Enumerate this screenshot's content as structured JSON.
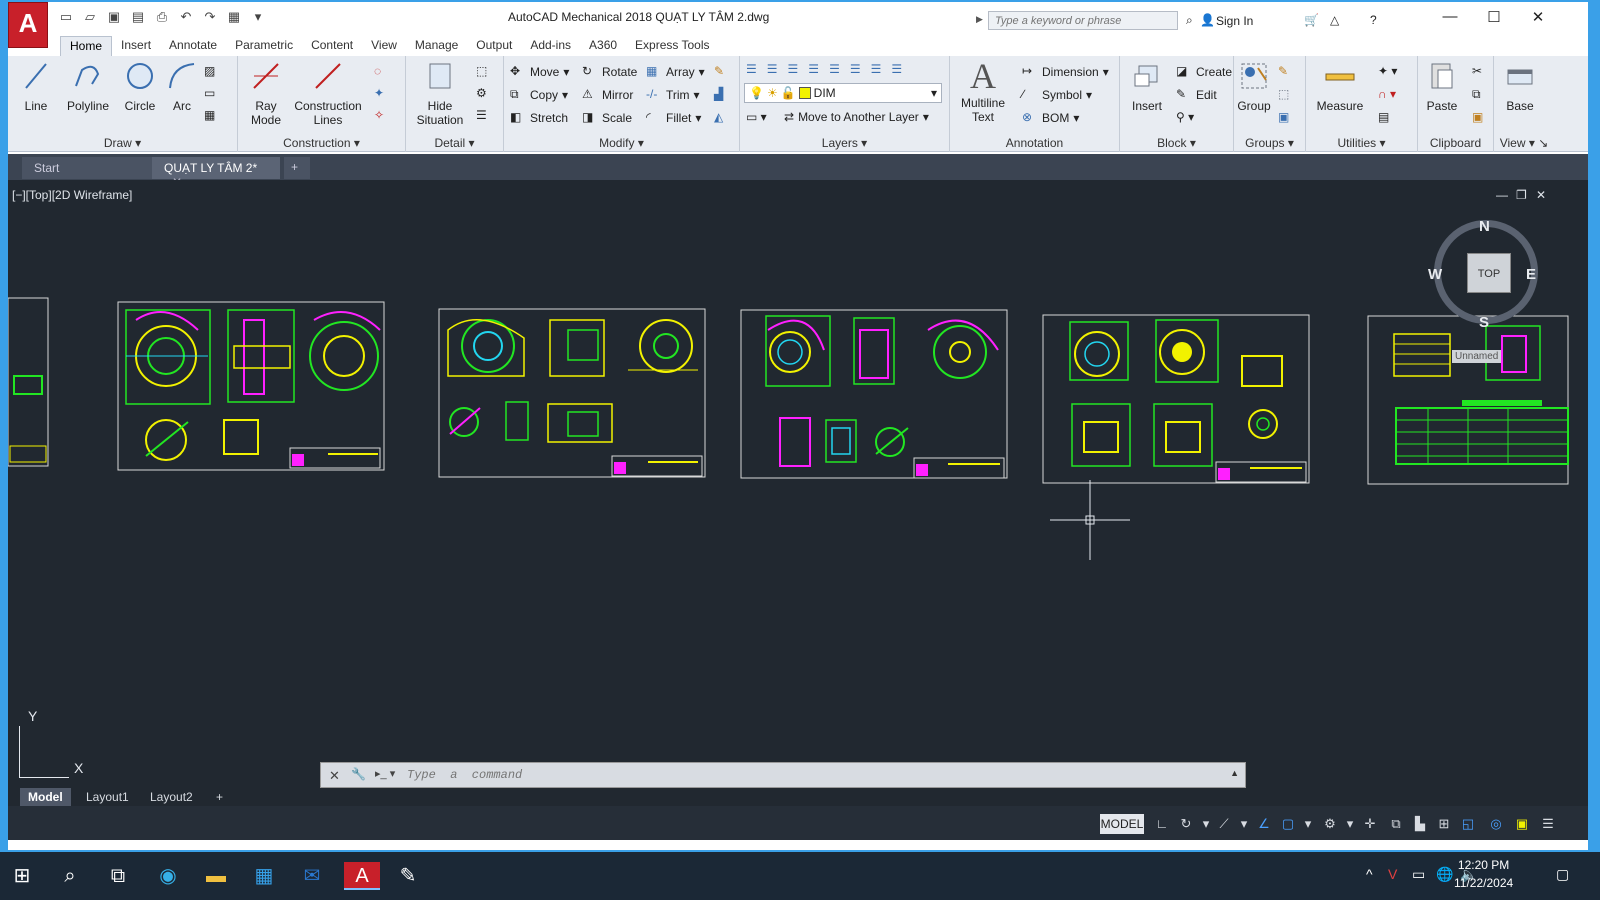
{
  "app": {
    "logo": "A",
    "title": "AutoCAD Mechanical 2018     QUẠT LY TÂM 2.dwg",
    "search_placeholder": "Type a keyword or phrase",
    "sign_in": "Sign In"
  },
  "ribbon_tabs": [
    "Home",
    "Insert",
    "Annotate",
    "Parametric",
    "Content",
    "View",
    "Manage",
    "Output",
    "Add-ins",
    "A360",
    "Express Tools"
  ],
  "panels": {
    "draw": {
      "title": "Draw",
      "line": "Line",
      "polyline": "Polyline",
      "circle": "Circle",
      "arc": "Arc"
    },
    "construction": {
      "title": "Construction",
      "ray": "Ray Mode",
      "lines": "Construction Lines"
    },
    "detail": {
      "title": "Detail",
      "hide": "Hide Situation"
    },
    "modify": {
      "title": "Modify",
      "move": "Move",
      "rotate": "Rotate",
      "array": "Array",
      "copy": "Copy",
      "mirror": "Mirror",
      "trim": "Trim",
      "stretch": "Stretch",
      "scale": "Scale",
      "fillet": "Fillet"
    },
    "layers": {
      "title": "Layers",
      "current_layer": "DIM",
      "move_to": "Move to Another Layer"
    },
    "annotation": {
      "title": "Annotation",
      "mtext": "Multiline Text",
      "dimension": "Dimension",
      "symbol": "Symbol",
      "bom": "BOM"
    },
    "block": {
      "title": "Block",
      "insert": "Insert",
      "create": "Create",
      "edit": "Edit"
    },
    "groups": {
      "title": "Groups",
      "group": "Group"
    },
    "utilities": {
      "title": "Utilities",
      "measure": "Measure"
    },
    "clipboard": {
      "title": "Clipboard",
      "paste": "Paste"
    },
    "view": {
      "title": "View",
      "base": "Base"
    }
  },
  "doc_tabs": {
    "start": "Start",
    "active": "QUẠT LY TÂM 2*"
  },
  "viewport": {
    "label": "[−][Top][2D Wireframe]",
    "viewcube_face": "TOP",
    "n": "N",
    "s": "S",
    "e": "E",
    "w": "W",
    "ucs_name": "Unnamed",
    "ucs_x": "X",
    "ucs_y": "Y"
  },
  "command": {
    "placeholder": "Type  a  command"
  },
  "layout_tabs": [
    "Model",
    "Layout1",
    "Layout2"
  ],
  "status": {
    "model": "MODEL"
  },
  "taskbar": {
    "time": "12:20 PM",
    "date": "11/22/2024"
  },
  "colors": {
    "accent": "#c8202a",
    "canvas": "#212830",
    "green": "#22e622",
    "yellow": "#f2f200",
    "magenta": "#ff20ff",
    "cyan": "#22d6f0"
  }
}
